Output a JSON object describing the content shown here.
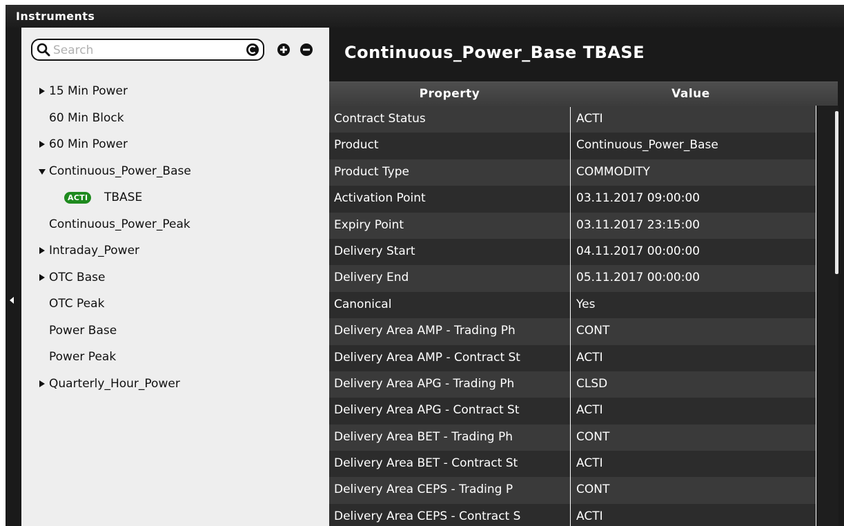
{
  "window": {
    "title": "Instruments"
  },
  "search": {
    "placeholder": "Search"
  },
  "tree": {
    "items": [
      {
        "label": "15 Min Power",
        "expand": "collapsed"
      },
      {
        "label": "60 Min Block",
        "expand": "none"
      },
      {
        "label": "60 Min Power",
        "expand": "collapsed"
      },
      {
        "label": "Continuous_Power_Base",
        "expand": "expanded"
      },
      {
        "label": "TBASE",
        "badge": "ACTI",
        "child": true
      },
      {
        "label": "Continuous_Power_Peak",
        "expand": "none"
      },
      {
        "label": "Intraday_Power",
        "expand": "collapsed"
      },
      {
        "label": "OTC Base",
        "expand": "collapsed"
      },
      {
        "label": "OTC Peak",
        "expand": "none"
      },
      {
        "label": "Power Base",
        "expand": "none"
      },
      {
        "label": "Power Peak",
        "expand": "none"
      },
      {
        "label": "Quarterly_Hour_Power",
        "expand": "collapsed"
      }
    ]
  },
  "detail": {
    "title": "Continuous_Power_Base TBASE",
    "columns": {
      "property": "Property",
      "value": "Value"
    },
    "rows": [
      {
        "property": "Contract Status",
        "value": "ACTI"
      },
      {
        "property": "Product",
        "value": "Continuous_Power_Base"
      },
      {
        "property": "Product Type",
        "value": "COMMODITY"
      },
      {
        "property": "Activation Point",
        "value": "03.11.2017 09:00:00"
      },
      {
        "property": "Expiry Point",
        "value": "03.11.2017 23:15:00"
      },
      {
        "property": "Delivery Start",
        "value": "04.11.2017 00:00:00"
      },
      {
        "property": "Delivery End",
        "value": "05.11.2017 00:00:00"
      },
      {
        "property": "Canonical",
        "value": "Yes"
      },
      {
        "property": "Delivery Area AMP - Trading Ph",
        "value": "CONT"
      },
      {
        "property": "Delivery Area AMP - Contract St",
        "value": "ACTI"
      },
      {
        "property": "Delivery Area APG - Trading Ph",
        "value": "CLSD"
      },
      {
        "property": "Delivery Area APG - Contract St",
        "value": "ACTI"
      },
      {
        "property": "Delivery Area BET - Trading Ph",
        "value": "CONT"
      },
      {
        "property": "Delivery Area BET - Contract St",
        "value": "ACTI"
      },
      {
        "property": "Delivery Area CEPS - Trading P",
        "value": "CONT"
      },
      {
        "property": "Delivery Area CEPS - Contract S",
        "value": "ACTI"
      }
    ]
  },
  "colors": {
    "window_bg": "#1a1a1a",
    "left_panel_bg": "#eeeeee",
    "row_even": "#3a3a3a",
    "row_odd": "#2c2c2c",
    "badge_green": "#1e8a1e"
  }
}
